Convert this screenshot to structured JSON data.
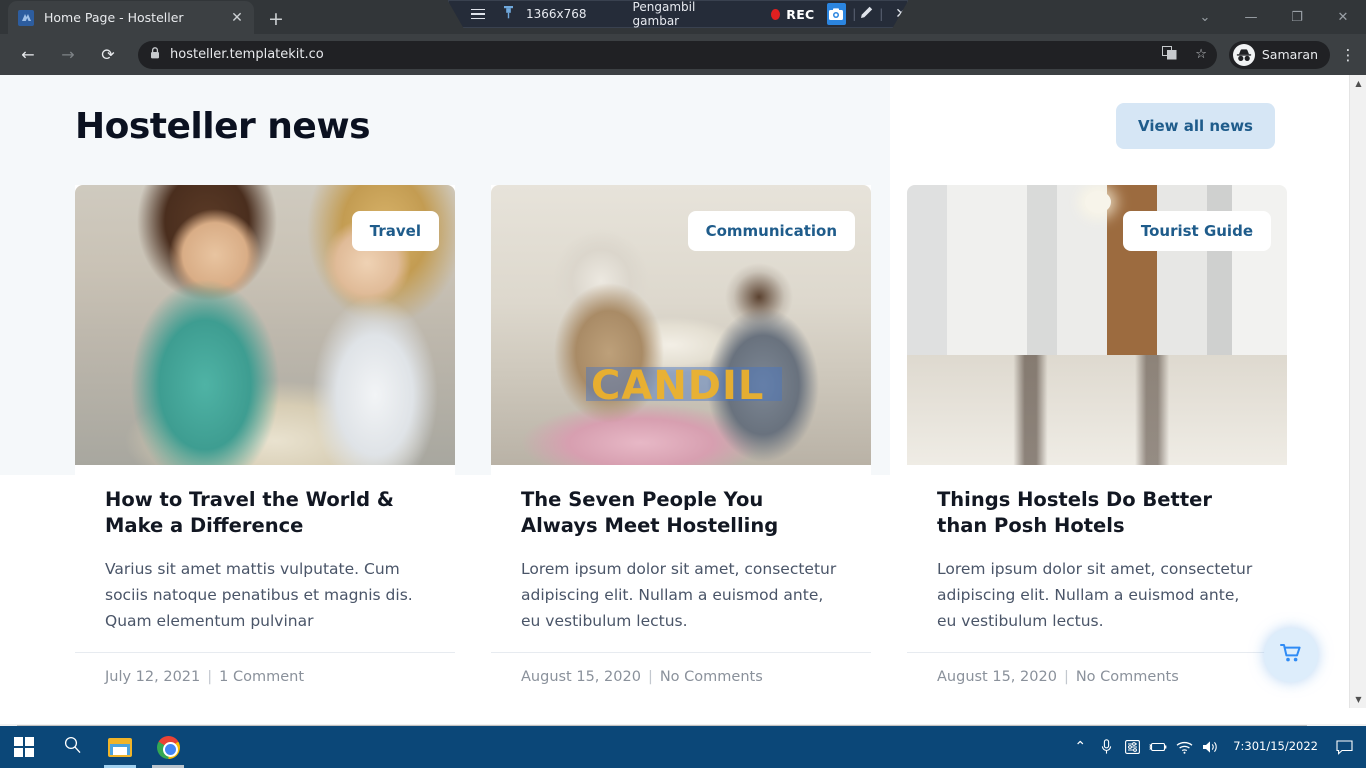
{
  "browser": {
    "tab": {
      "title": "Home Page - Hosteller",
      "favicon_label": "H",
      "close_icon": "✕"
    },
    "new_tab_icon": "+",
    "nav": {
      "back_icon": "←",
      "forward_icon": "→",
      "reload_icon": "⟳"
    },
    "omnibox": {
      "lock_icon": "🔒",
      "url": "hosteller.templatekit.co",
      "translate_icon": "⎘",
      "bookmark_icon": "☆"
    },
    "profile": {
      "name": "Samaran",
      "avatar_icon": "incognito-icon"
    },
    "menu_icon": "⋮",
    "window_controls": {
      "expand": "⌄",
      "minimize": "—",
      "restore": "❐",
      "close": "✕"
    }
  },
  "recorder": {
    "menu_icon": "hamburger-icon",
    "pin_icon": "⇟",
    "resolution": "1366x768",
    "title": "Pengambil gambar",
    "rec_label": "REC",
    "camera_icon": "📷",
    "pen_icon": "✎",
    "close_icon": "✕",
    "separator": "|"
  },
  "page": {
    "heading": "Hosteller news",
    "view_all_label": "View all news",
    "watermark": "CANDIL",
    "cart_icon": "cart-icon",
    "meta_separator": "|",
    "cards": [
      {
        "badge": "Travel",
        "title": "How to Travel the World & Make a Difference",
        "excerpt": "Varius sit amet mattis vulputate. Cum sociis natoque penatibus et magnis dis. Quam elementum pulvinar",
        "date": "July 12, 2021",
        "comments": "1 Comment"
      },
      {
        "badge": "Communication",
        "title": "The Seven People You Always Meet Hostelling",
        "excerpt": "Lorem ipsum dolor sit amet, consectetur adipiscing elit. Nullam a euismod ante, eu vestibulum lectus.",
        "date": "August 15, 2020",
        "comments": "No Comments"
      },
      {
        "badge": "Tourist Guide",
        "title": "Things Hostels Do Better than Posh Hotels",
        "excerpt": "Lorem ipsum dolor sit amet, consectetur adipiscing elit. Nullam a euismod ante, eu vestibulum lectus.",
        "date": "August 15, 2020",
        "comments": "No Comments"
      }
    ]
  },
  "scrollbar": {
    "up_arrow": "▲",
    "down_arrow": "▼",
    "left_arrow": "◀",
    "right_arrow": "▶"
  },
  "taskbar": {
    "start_icon": "windows-icon",
    "search_icon": "⌕",
    "apps": [
      "file-explorer-icon",
      "chrome-icon"
    ],
    "tray": {
      "chevron": "⌃",
      "mic_icon": "🎤",
      "equalizer_icon": "⚙",
      "battery_icon": "🔋",
      "wifi_icon": "📶",
      "volume_icon": "🔊",
      "time": "7:30",
      "date": "1/15/2022",
      "notification_icon": "🗨"
    }
  },
  "colors": {
    "accent_blue": "#1f5c8b",
    "button_bg": "#d6e6f5",
    "page_bg": "#f5f8fa",
    "taskbar": "#0b4778",
    "rec_red": "#e02020"
  }
}
